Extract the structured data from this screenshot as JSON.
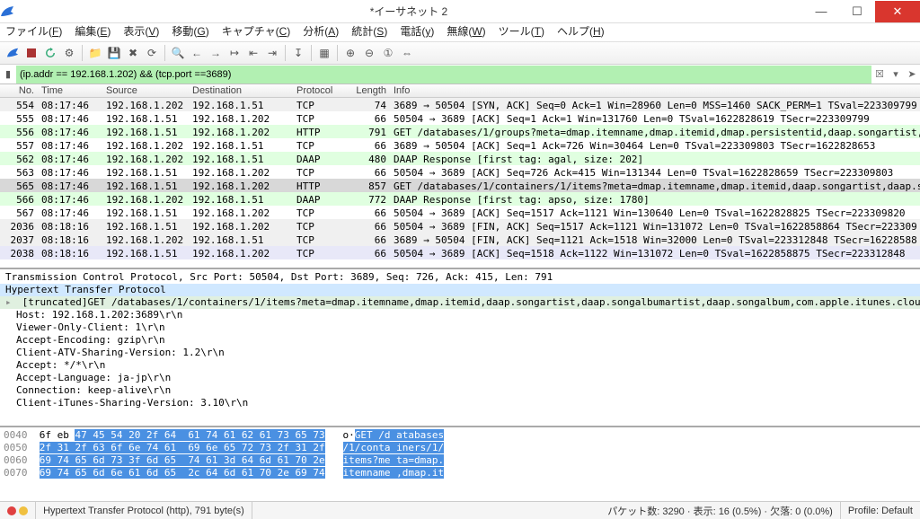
{
  "window": {
    "title": "*イーサネット 2"
  },
  "menu": [
    "ファイル(F)",
    "編集(E)",
    "表示(V)",
    "移動(G)",
    "キャプチャ(C)",
    "分析(A)",
    "統計(S)",
    "電話(y)",
    "無線(W)",
    "ツール(T)",
    "ヘルプ(H)"
  ],
  "filter": {
    "value": "(ip.addr == 192.168.1.202) && (tcp.port ==3689)"
  },
  "columns": [
    "No.",
    "Time",
    "Source",
    "Destination",
    "Protocol",
    "Length",
    "Info"
  ],
  "packets": [
    {
      "cls": "gray",
      "no": "554",
      "time": "08:17:46",
      "src": "192.168.1.202",
      "dst": "192.168.1.51",
      "proto": "TCP",
      "len": "74",
      "info": "3689 → 50504 [SYN, ACK] Seq=0 Ack=1 Win=28960 Len=0 MSS=1460 SACK_PERM=1 TSval=223309799"
    },
    {
      "cls": "",
      "no": "555",
      "time": "08:17:46",
      "src": "192.168.1.51",
      "dst": "192.168.1.202",
      "proto": "TCP",
      "len": "66",
      "info": "50504 → 3689 [ACK] Seq=1 Ack=1 Win=131760 Len=0 TSval=1622828619 TSecr=223309799"
    },
    {
      "cls": "green",
      "no": "556",
      "time": "08:17:46",
      "src": "192.168.1.51",
      "dst": "192.168.1.202",
      "proto": "HTTP",
      "len": "791",
      "info": "GET /databases/1/groups?meta=dmap.itemname,dmap.itemid,dmap.persistentid,daap.songartist,"
    },
    {
      "cls": "",
      "no": "557",
      "time": "08:17:46",
      "src": "192.168.1.202",
      "dst": "192.168.1.51",
      "proto": "TCP",
      "len": "66",
      "info": "3689 → 50504 [ACK] Seq=1 Ack=726 Win=30464 Len=0 TSval=223309803 TSecr=1622828653"
    },
    {
      "cls": "green",
      "no": "562",
      "time": "08:17:46",
      "src": "192.168.1.202",
      "dst": "192.168.1.51",
      "proto": "DAAP",
      "len": "480",
      "info": "DAAP Response [first tag: agal, size: 202]"
    },
    {
      "cls": "",
      "no": "563",
      "time": "08:17:46",
      "src": "192.168.1.51",
      "dst": "192.168.1.202",
      "proto": "TCP",
      "len": "66",
      "info": "50504 → 3689 [ACK] Seq=726 Ack=415 Win=131344 Len=0 TSval=1622828659 TSecr=223309803"
    },
    {
      "cls": "sel",
      "no": "565",
      "time": "08:17:46",
      "src": "192.168.1.51",
      "dst": "192.168.1.202",
      "proto": "HTTP",
      "len": "857",
      "info": "GET /databases/1/containers/1/items?meta=dmap.itemname,dmap.itemid,daap.songartist,daap.s"
    },
    {
      "cls": "green",
      "no": "566",
      "time": "08:17:46",
      "src": "192.168.1.202",
      "dst": "192.168.1.51",
      "proto": "DAAP",
      "len": "772",
      "info": "DAAP Response [first tag: apso, size: 1780]"
    },
    {
      "cls": "",
      "no": "567",
      "time": "08:17:46",
      "src": "192.168.1.51",
      "dst": "192.168.1.202",
      "proto": "TCP",
      "len": "66",
      "info": "50504 → 3689 [ACK] Seq=1517 Ack=1121 Win=130640 Len=0 TSval=1622828825 TSecr=223309820"
    },
    {
      "cls": "gray",
      "no": "2036",
      "time": "08:18:16",
      "src": "192.168.1.51",
      "dst": "192.168.1.202",
      "proto": "TCP",
      "len": "66",
      "info": "50504 → 3689 [FIN, ACK] Seq=1517 Ack=1121 Win=131072 Len=0 TSval=1622858864 TSecr=223309"
    },
    {
      "cls": "gray",
      "no": "2037",
      "time": "08:18:16",
      "src": "192.168.1.202",
      "dst": "192.168.1.51",
      "proto": "TCP",
      "len": "66",
      "info": "3689 → 50504 [FIN, ACK] Seq=1121 Ack=1518 Win=32000 Len=0 TSval=223312848 TSecr=16228588"
    },
    {
      "cls": "purple",
      "no": "2038",
      "time": "08:18:16",
      "src": "192.168.1.51",
      "dst": "192.168.1.202",
      "proto": "TCP",
      "len": "66",
      "info": "50504 → 3689 [ACK] Seq=1518 Ack=1122 Win=131072 Len=0 TSval=1622858875 TSecr=223312848"
    }
  ],
  "details": [
    {
      "lvl": "l1 tri",
      "txt": "Transmission Control Protocol, Src Port: 50504, Dst Port: 3689, Seq: 726, Ack: 415, Len: 791"
    },
    {
      "lvl": "l1 triopen hl",
      "txt": "Hypertext Transfer Protocol"
    },
    {
      "lvl": "hl2 tri",
      "txt": "   [truncated]GET /databases/1/containers/1/items?meta=dmap.itemname,dmap.itemid,daap.songartist,daap.songalbumartist,daap.songalbum,com.apple.itunes.clou"
    },
    {
      "lvl": "",
      "txt": "   Host: 192.168.1.202:3689\\r\\n"
    },
    {
      "lvl": "",
      "txt": "   Viewer-Only-Client: 1\\r\\n"
    },
    {
      "lvl": "",
      "txt": "   Accept-Encoding: gzip\\r\\n"
    },
    {
      "lvl": "",
      "txt": "   Client-ATV-Sharing-Version: 1.2\\r\\n"
    },
    {
      "lvl": "",
      "txt": "   Accept: */*\\r\\n"
    },
    {
      "lvl": "",
      "txt": "   Accept-Language: ja-jp\\r\\n"
    },
    {
      "lvl": "",
      "txt": "   Connection: keep-alive\\r\\n"
    },
    {
      "lvl": "",
      "txt": "   Client-iTunes-Sharing-Version: 3.10\\r\\n"
    }
  ],
  "hex": [
    {
      "off": "0040",
      "h1": "6f eb ",
      "h2": "47 45 54 20 2f 64  61 74 61 62 61 73 65 73",
      "a1": "o·",
      "a2": "GET /d atabases"
    },
    {
      "off": "0050",
      "h1": "",
      "h2": "2f 31 2f 63 6f 6e 74 61  69 6e 65 72 73 2f 31 2f",
      "a1": "",
      "a2": "/1/conta iners/1/"
    },
    {
      "off": "0060",
      "h1": "",
      "h2": "69 74 65 6d 73 3f 6d 65  74 61 3d 64 6d 61 70 2e",
      "a1": "",
      "a2": "items?me ta=dmap."
    },
    {
      "off": "0070",
      "h1": "",
      "h2": "69 74 65 6d 6e 61 6d 65  2c 64 6d 61 70 2e 69 74",
      "a1": "",
      "a2": "itemname ,dmap.it"
    }
  ],
  "status": {
    "left": "Hypertext Transfer Protocol (http), 791 byte(s)",
    "mid": "パケット数: 3290 · 表示: 16 (0.5%) · 欠落: 0 (0.0%)",
    "right": "Profile: Default"
  }
}
